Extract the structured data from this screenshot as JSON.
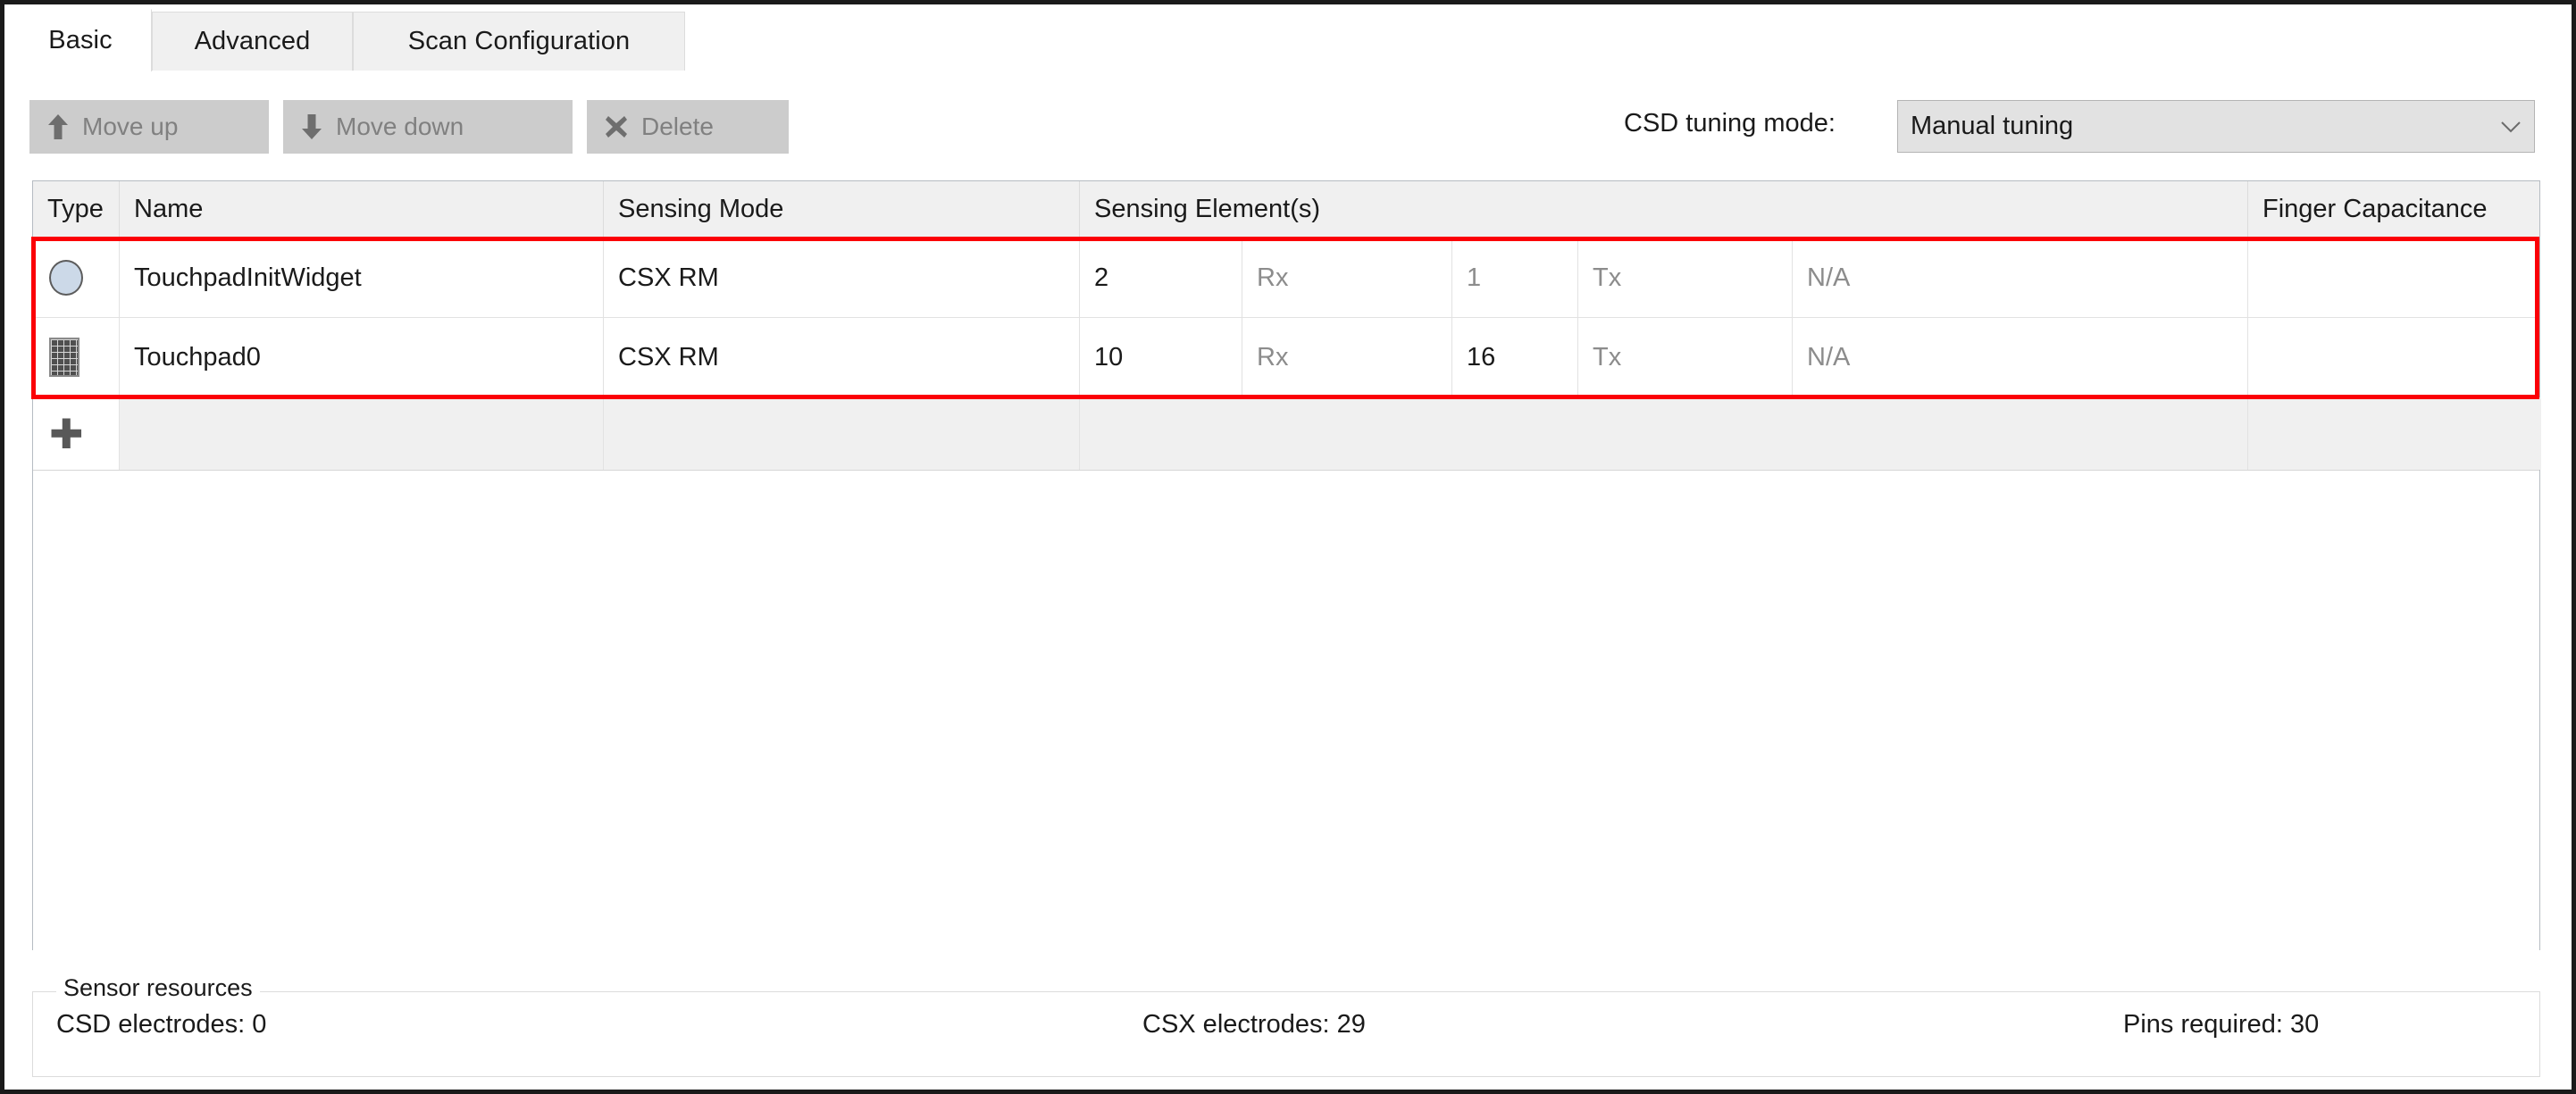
{
  "window": {
    "accent_selection_color": "#fb0007",
    "toolbar_disabled_color": "#808080"
  },
  "tabs": [
    {
      "label": "Basic",
      "active": true
    },
    {
      "label": "Advanced",
      "active": false
    },
    {
      "label": "Scan Configuration",
      "active": false
    }
  ],
  "toolbar": {
    "move_up_label": "Move up",
    "move_down_label": "Move down",
    "delete_label": "Delete",
    "csd_tuning_mode_label": "CSD tuning mode:",
    "csd_tuning_mode_value": "Manual tuning"
  },
  "table": {
    "columns": [
      "Type",
      "Name",
      "Sensing Mode",
      "Sensing Element(s)",
      "Finger Capacitance"
    ],
    "rows": [
      {
        "type_icon": "circle-button-icon",
        "name": "TouchpadInitWidget",
        "sensing_mode": "CSX RM",
        "rx_count": "2",
        "rx_label": "Rx",
        "tx_count": "1",
        "tx_label": "Tx",
        "finger_capacitance": "N/A",
        "selected": true
      },
      {
        "type_icon": "touchpad-matrix-icon",
        "name": "Touchpad0",
        "sensing_mode": "CSX RM",
        "rx_count": "10",
        "rx_label": "Rx",
        "tx_count": "16",
        "tx_label": "Tx",
        "finger_capacitance": "N/A",
        "selected": true
      }
    ],
    "add_row_icon": "plus-icon"
  },
  "sensor_resources": {
    "title": "Sensor resources",
    "csd_electrodes": "CSD electrodes:  0",
    "csx_electrodes": "CSX electrodes:  29",
    "pins_required": "Pins required:  30"
  }
}
